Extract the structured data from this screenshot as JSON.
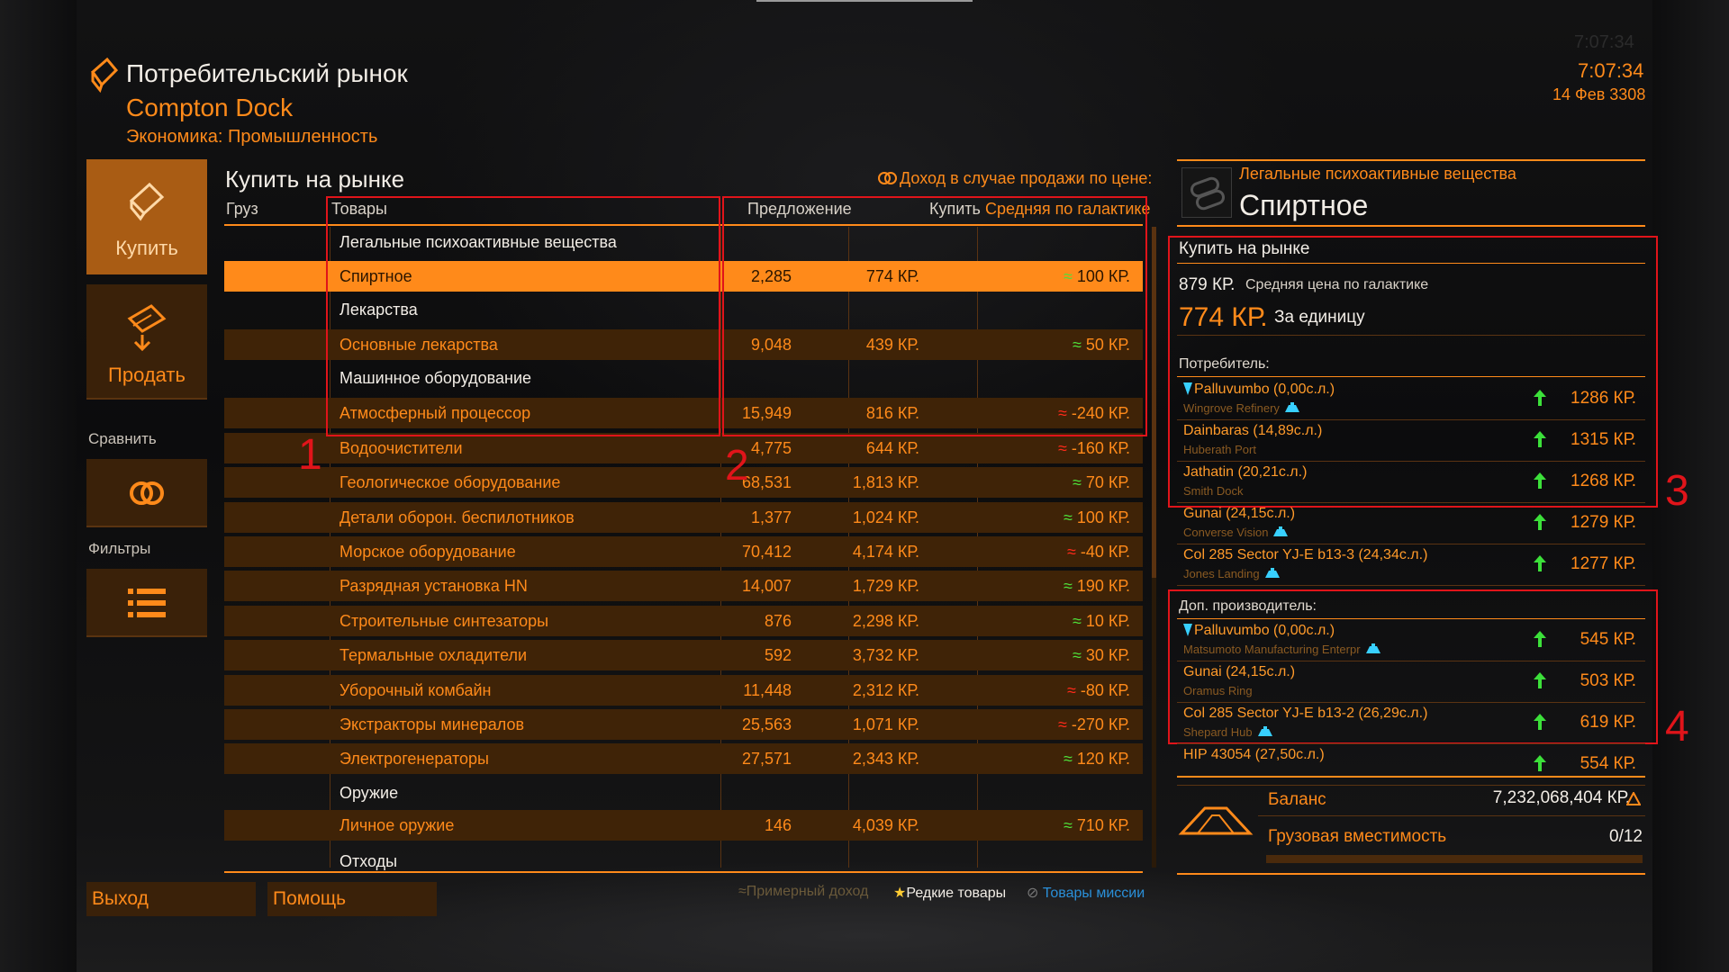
{
  "header": {
    "title": "Потребительский рынок",
    "station": "Compton Dock",
    "economy": "Экономика: Промышленность",
    "time_ghost": "7:07:34",
    "time": "7:07:34",
    "date": "14 Фев 3308"
  },
  "nav": {
    "buy": "Купить",
    "sell": "Продать",
    "compare_label": "Сравнить",
    "filters_label": "Фильтры"
  },
  "market": {
    "title": "Купить на рынке",
    "profit_hint": "Доход в случае продажи по цене:",
    "columns": {
      "cargo": "Груз",
      "goods": "Товары",
      "supply": "Предложение",
      "buy": "Купить",
      "galactic_avg": "Средняя по галактике"
    },
    "rows": [
      {
        "type": "cat",
        "name": "Легальные психоактивные вещества"
      },
      {
        "type": "sel",
        "name": "Спиртное",
        "supply": "2,285",
        "buy": "774 КР.",
        "trend": "≈",
        "trend_color": "g",
        "avg": "100 КР."
      },
      {
        "type": "cat",
        "name": "Лекарства"
      },
      {
        "type": "item",
        "name": "Основные лекарства",
        "supply": "9,048",
        "buy": "439 КР.",
        "trend": "≈",
        "trend_color": "g",
        "avg": "50 КР."
      },
      {
        "type": "cat",
        "name": "Машинное оборудование"
      },
      {
        "type": "item",
        "name": "Атмосферный процессор",
        "supply": "15,949",
        "buy": "816 КР.",
        "trend": "≈",
        "trend_color": "r",
        "avg": "-240 КР."
      },
      {
        "type": "item",
        "name": "Водоочистители",
        "supply": "4,775",
        "buy": "644 КР.",
        "trend": "≈",
        "trend_color": "r",
        "avg": "-160 КР."
      },
      {
        "type": "item",
        "name": "Геологическое оборудование",
        "supply": "68,531",
        "buy": "1,813 КР.",
        "trend": "≈",
        "trend_color": "g",
        "avg": "70 КР."
      },
      {
        "type": "item",
        "name": "Детали оборон. беспилотников",
        "supply": "1,377",
        "buy": "1,024 КР.",
        "trend": "≈",
        "trend_color": "g",
        "avg": "100 КР."
      },
      {
        "type": "item",
        "name": "Морское оборудование",
        "supply": "70,412",
        "buy": "4,174 КР.",
        "trend": "≈",
        "trend_color": "r",
        "avg": "-40 КР."
      },
      {
        "type": "item",
        "name": "Разрядная установка HN",
        "supply": "14,007",
        "buy": "1,729 КР.",
        "trend": "≈",
        "trend_color": "g",
        "avg": "190 КР."
      },
      {
        "type": "item",
        "name": "Строительные синтезаторы",
        "supply": "876",
        "buy": "2,298 КР.",
        "trend": "≈",
        "trend_color": "g",
        "avg": "10 КР."
      },
      {
        "type": "item",
        "name": "Термальные охладители",
        "supply": "592",
        "buy": "3,732 КР.",
        "trend": "≈",
        "trend_color": "g",
        "avg": "30 КР."
      },
      {
        "type": "item",
        "name": "Уборочный комбайн",
        "supply": "11,448",
        "buy": "2,312 КР.",
        "trend": "≈",
        "trend_color": "r",
        "avg": "-80 КР."
      },
      {
        "type": "item",
        "name": "Экстракторы минералов",
        "supply": "25,563",
        "buy": "1,071 КР.",
        "trend": "≈",
        "trend_color": "r",
        "avg": "-270 КР."
      },
      {
        "type": "item",
        "name": "Электрогенераторы",
        "supply": "27,571",
        "buy": "2,343 КР.",
        "trend": "≈",
        "trend_color": "g",
        "avg": "120 КР."
      },
      {
        "type": "cat",
        "name": "Оружие"
      },
      {
        "type": "item",
        "name": "Личное оружие",
        "supply": "146",
        "buy": "4,039 КР.",
        "trend": "≈",
        "trend_color": "g",
        "avg": "710 КР."
      },
      {
        "type": "cat",
        "name": "Отходы"
      }
    ],
    "annotations": [
      "1",
      "2",
      "3",
      "4"
    ],
    "legend": {
      "approx": "Примерный доход",
      "rare": "Редкие товары",
      "mission": "Товары миссии"
    }
  },
  "detail": {
    "category": "Легальные психоактивные вещества",
    "name": "Спиртное",
    "section": "Купить на рынке",
    "avg_value": "879 КР.",
    "avg_label": "Средняя цена по галактике",
    "price": "774 КР.",
    "unit": "За единицу",
    "consumers_label": "Потребитель:",
    "consumers": [
      {
        "system": "Palluvumbo (0,00с.л.)",
        "station": "Wingrove Refinery",
        "price": "1286 КР.",
        "pin": true,
        "pad": true
      },
      {
        "system": "Dainbaras (14,89с.л.)",
        "station": "Huberath Port",
        "price": "1315 КР.",
        "pin": false,
        "pad": false
      },
      {
        "system": "Jathatin (20,21с.л.)",
        "station": "Smith Dock",
        "price": "1268 КР.",
        "pin": false,
        "pad": false
      },
      {
        "system": "Gunai (24,15с.л.)",
        "station": "Converse Vision",
        "price": "1279 КР.",
        "pin": false,
        "pad": true
      },
      {
        "system": "Col 285 Sector YJ-E b13-3 (24,34с.л.)",
        "station": "Jones Landing",
        "price": "1277 КР.",
        "pin": false,
        "pad": true
      }
    ],
    "producers_label": "Доп. производитель:",
    "producers": [
      {
        "system": "Palluvumbo (0,00с.л.)",
        "station": "Matsumoto Manufacturing Enterpr",
        "price": "545 КР.",
        "pin": true,
        "pad": true
      },
      {
        "system": "Gunai (24,15с.л.)",
        "station": "Oramus Ring",
        "price": "503 КР.",
        "pin": false,
        "pad": false
      },
      {
        "system": "Col 285 Sector YJ-E b13-2 (26,29с.л.)",
        "station": "Shepard Hub",
        "price": "619 КР.",
        "pin": false,
        "pad": true
      },
      {
        "system": "HIP 43054 (27,50с.л.)",
        "station": "",
        "price": "554 КР.",
        "pin": false,
        "pad": false
      }
    ],
    "balance_label": "Баланс",
    "balance": "7,232,068,404 КР.",
    "cargo_label": "Грузовая вместимость",
    "cargo": "0/12",
    "cargo_fill": 0
  },
  "footer": {
    "exit": "Выход",
    "help": "Помощь"
  },
  "colors": {
    "accent": "#ff8a1a",
    "row_bg": "#3f2307",
    "annotation": "#e0141a",
    "trend_up": "#4fe03a",
    "trend_down": "#ff2a1a"
  }
}
